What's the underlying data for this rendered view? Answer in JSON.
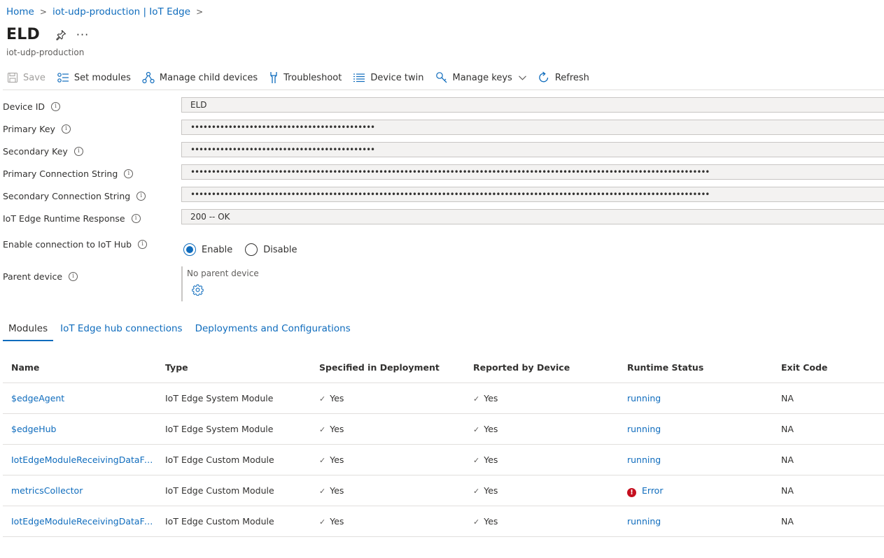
{
  "breadcrumb": [
    {
      "label": "Home"
    },
    {
      "label": "iot-udp-production | IoT Edge"
    }
  ],
  "header": {
    "title": "ELD",
    "more": "···",
    "subtitle": "iot-udp-production"
  },
  "toolbar": {
    "save": "Save",
    "set_modules": "Set modules",
    "manage_child": "Manage child devices",
    "troubleshoot": "Troubleshoot",
    "device_twin": "Device twin",
    "manage_keys": "Manage keys",
    "refresh": "Refresh"
  },
  "form": {
    "device_id": {
      "label": "Device ID",
      "value": "ELD"
    },
    "primary_key": {
      "label": "Primary Key",
      "value": "••••••••••••••••••••••••••••••••••••••••••••"
    },
    "secondary_key": {
      "label": "Secondary Key",
      "value": "••••••••••••••••••••••••••••••••••••••••••••"
    },
    "primary_conn": {
      "label": "Primary Connection String",
      "value": "••••••••••••••••••••••••••••••••••••••••••••••••••••••••••••••••••••••••••••••••••••••••••••••••••••••••••••••••••••••••••••"
    },
    "secondary_conn": {
      "label": "Secondary Connection String",
      "value": "••••••••••••••••••••••••••••••••••••••••••••••••••••••••••••••••••••••••••••••••••••••••••••••••••••••••••••••••••••••••••••"
    },
    "runtime_response": {
      "label": "IoT Edge Runtime Response",
      "value": "200 -- OK"
    },
    "enable_conn": {
      "label": "Enable connection to IoT Hub",
      "enable": "Enable",
      "disable": "Disable",
      "selected": "Enable"
    },
    "parent": {
      "label": "Parent device",
      "value": "No parent device"
    }
  },
  "tabs": [
    {
      "label": "Modules",
      "active": true
    },
    {
      "label": "IoT Edge hub connections",
      "active": false
    },
    {
      "label": "Deployments and Configurations",
      "active": false
    }
  ],
  "table": {
    "columns": [
      "Name",
      "Type",
      "Specified in Deployment",
      "Reported by Device",
      "Runtime Status",
      "Exit Code"
    ],
    "rows": [
      {
        "name": "$edgeAgent",
        "type": "IoT Edge System Module",
        "specified": "Yes",
        "reported": "Yes",
        "status": "running",
        "exit": "NA"
      },
      {
        "name": "$edgeHub",
        "type": "IoT Edge System Module",
        "specified": "Yes",
        "reported": "Yes",
        "status": "running",
        "exit": "NA"
      },
      {
        "name": "IotEdgeModuleReceivingDataFro...",
        "type": "IoT Edge Custom Module",
        "specified": "Yes",
        "reported": "Yes",
        "status": "running",
        "exit": "NA"
      },
      {
        "name": "metricsCollector",
        "type": "IoT Edge Custom Module",
        "specified": "Yes",
        "reported": "Yes",
        "status": "Error",
        "exit": "NA"
      },
      {
        "name": "IotEdgeModuleReceivingDataFro...",
        "type": "IoT Edge Custom Module",
        "specified": "Yes",
        "reported": "Yes",
        "status": "running",
        "exit": "NA"
      }
    ]
  },
  "colors": {
    "link": "#0f6cbd",
    "error": "#c50f1f",
    "border": "#c8c6c4"
  }
}
